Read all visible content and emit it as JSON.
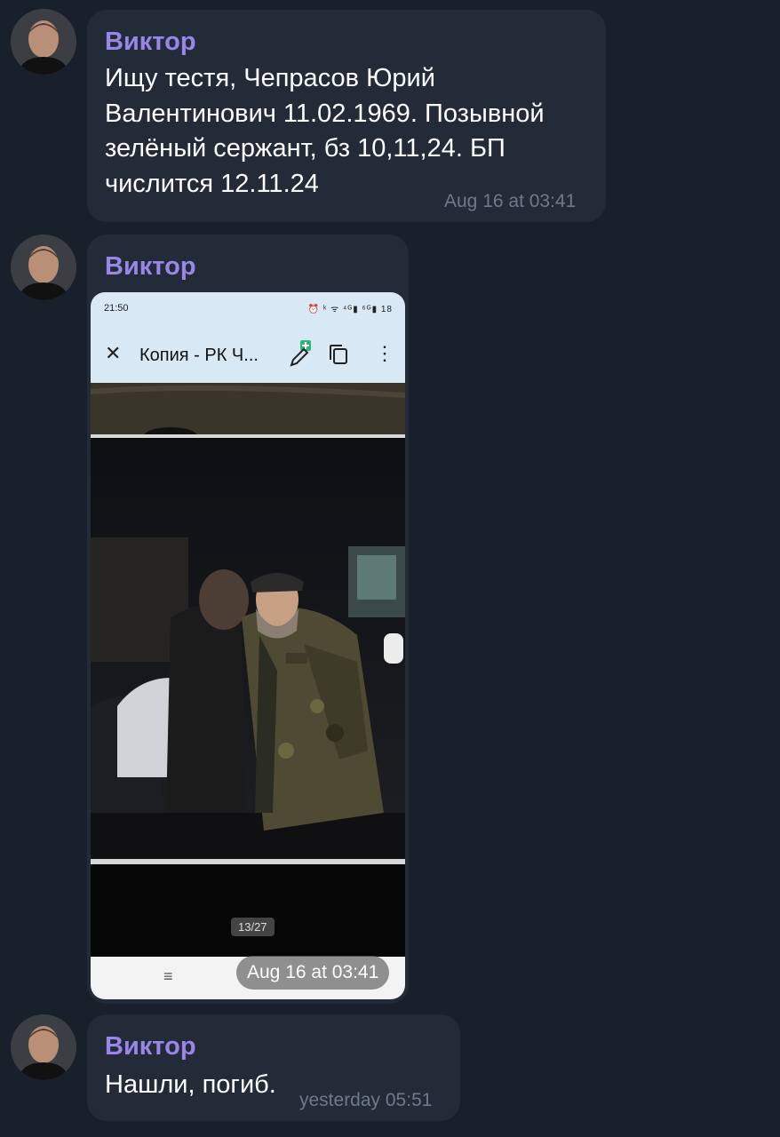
{
  "messages": [
    {
      "sender": "Виктор",
      "lines": [
        "Ищу тестя, Чепрасов Юрий",
        "Валентинович 11.02.1969. Позывной",
        "зелёный сержант, бз 10,11,24. БП",
        "числится 12.11.24"
      ],
      "time": "Aug 16 at 03:41"
    },
    {
      "sender": "Виктор",
      "time": "Aug 16 at 03:41",
      "screenshot": {
        "status_time": "21:50",
        "status_icons": "⏰ ᵏ ᯤ ⁴ᴳ▮ ⁶ᴳ▮ 18",
        "toolbar_title": "Копия - РК Ч...",
        "close_icon": "✕",
        "more_icon": "⋮",
        "page_indicator": "13/27",
        "nav_menu_icon": "≡"
      }
    },
    {
      "sender": "Виктор",
      "text": "Нашли, погиб.",
      "time": "yesterday 05:51"
    }
  ],
  "colors": {
    "background": "#18202b",
    "bubble": "#222b37",
    "sender": "#9a86e8",
    "time": "#6f7a88"
  }
}
